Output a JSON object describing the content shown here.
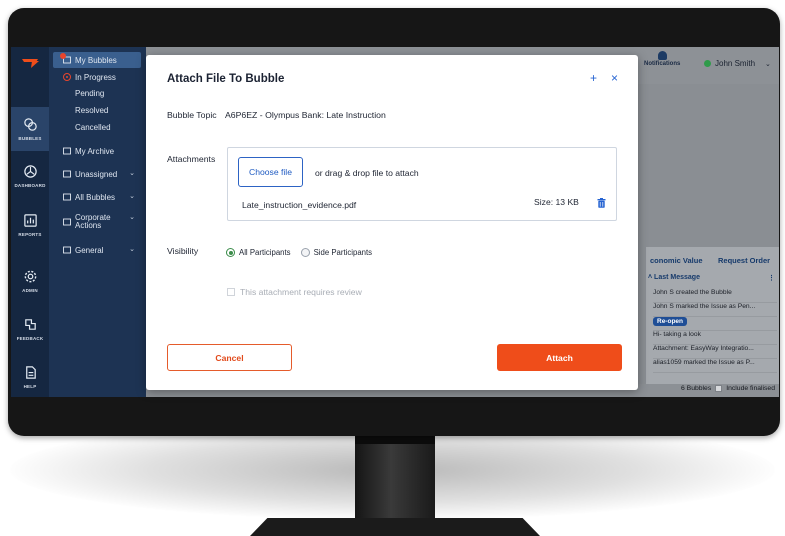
{
  "rail": {
    "items": [
      {
        "label": "BUBBLES",
        "icon": "bubbles-icon"
      },
      {
        "label": "DASHBOARD",
        "icon": "dashboard-icon"
      },
      {
        "label": "REPORTS",
        "icon": "reports-icon"
      },
      {
        "label": "ADMIN",
        "icon": "gear-icon"
      },
      {
        "label": "FEEDBACK",
        "icon": "feedback-icon"
      },
      {
        "label": "HELP",
        "icon": "help-icon"
      }
    ]
  },
  "sidebar": {
    "my_bubbles": "My Bubbles",
    "in_progress": "In Progress",
    "pending": "Pending",
    "resolved": "Resolved",
    "cancelled": "Cancelled",
    "my_archive": "My Archive",
    "unassigned": "Unassigned",
    "all_bubbles": "All Bubbles",
    "corporate_1": "Corporate",
    "corporate_2": "Actions",
    "general": "General"
  },
  "header": {
    "notifications": "Notifications",
    "user_name": "John Smith"
  },
  "table": {
    "col_economic": "conomic Value",
    "col_request": "Request Order",
    "col_last_message": "Last Message",
    "rows": [
      "John S created the Bubble",
      "John S marked the Issue as Pen...",
      "Re-open",
      "Hi- taking a look",
      "Attachment: EasyWay Integratio...",
      "alias1059 marked the Issue as P..."
    ],
    "count_label": "6 Bubbles",
    "include_finalised": "Include finalised"
  },
  "modal": {
    "title": "Attach File To Bubble",
    "topic_label": "Bubble Topic",
    "topic_value": "A6P6EZ - Olympus Bank: Late Instruction",
    "attachments_label": "Attachments",
    "choose_file": "Choose file",
    "drag_text": "or drag & drop file to attach",
    "file_name": "Late_instruction_evidence.pdf",
    "file_size": "Size: 13 KB",
    "visibility_label": "Visibility",
    "option_all": "All Participants",
    "option_side": "Side Participants",
    "review_label": "This attachment requires review",
    "cancel": "Cancel",
    "attach": "Attach",
    "add_symbol": "+",
    "close_symbol": "×"
  },
  "colors": {
    "accent_orange": "#ef4d1a",
    "link_blue": "#2563d2",
    "sidebar_navy": "#1d3353"
  }
}
